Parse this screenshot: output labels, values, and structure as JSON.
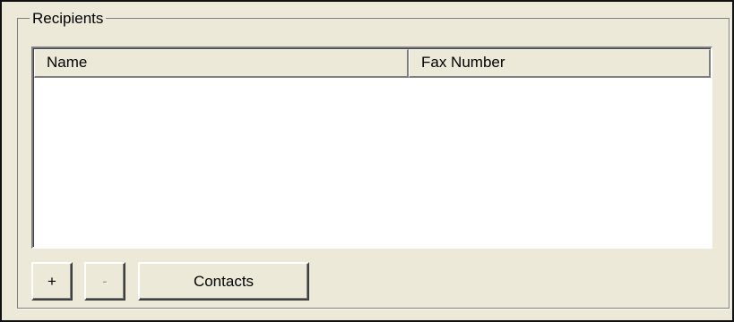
{
  "recipients": {
    "group_label": "Recipients",
    "columns": [
      "Name",
      "Fax Number"
    ],
    "rows": []
  },
  "buttons": {
    "add_label": "+",
    "remove_label": "-",
    "contacts_label": "Contacts"
  }
}
